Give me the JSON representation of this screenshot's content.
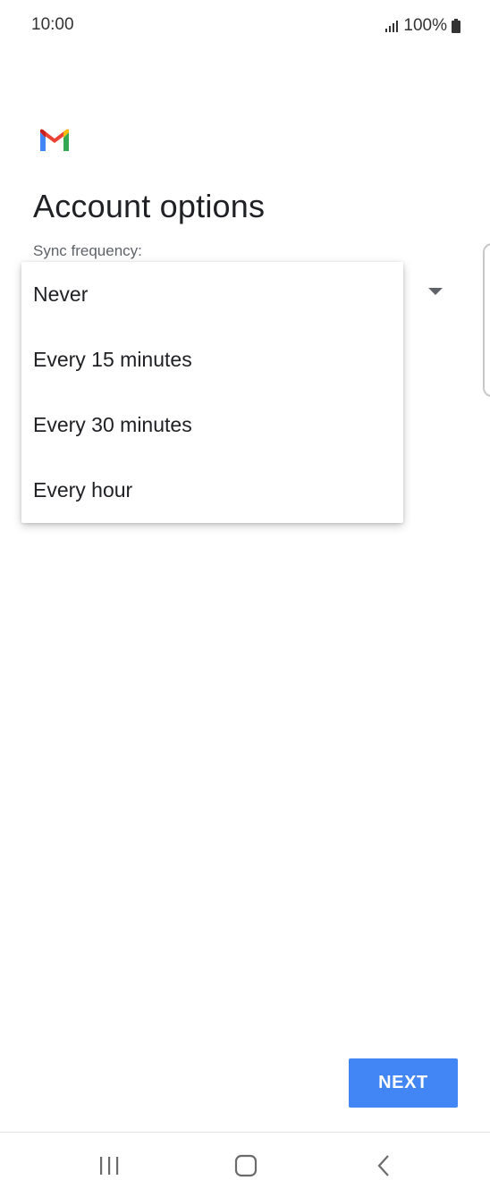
{
  "status_bar": {
    "time": "10:00",
    "battery_percent": "100%",
    "icons": [
      "signal-icon",
      "battery-icon"
    ]
  },
  "app": {
    "logo": "gmail-logo",
    "title": "Account options"
  },
  "sync": {
    "label": "Sync frequency:",
    "options": [
      {
        "label": "Never"
      },
      {
        "label": "Every 15 minutes"
      },
      {
        "label": "Every 30 minutes"
      },
      {
        "label": "Every hour"
      }
    ]
  },
  "actions": {
    "next_label": "NEXT"
  },
  "navigation": {
    "icons": [
      "recent-apps-icon",
      "home-icon",
      "back-icon"
    ]
  },
  "colors": {
    "accent": "#4285f4",
    "text_primary": "#202124",
    "text_secondary": "#5f6368",
    "gmail_red": "#ea4335",
    "gmail_blue": "#4285f4",
    "gmail_green": "#34a853",
    "gmail_yellow": "#fbbc04"
  }
}
